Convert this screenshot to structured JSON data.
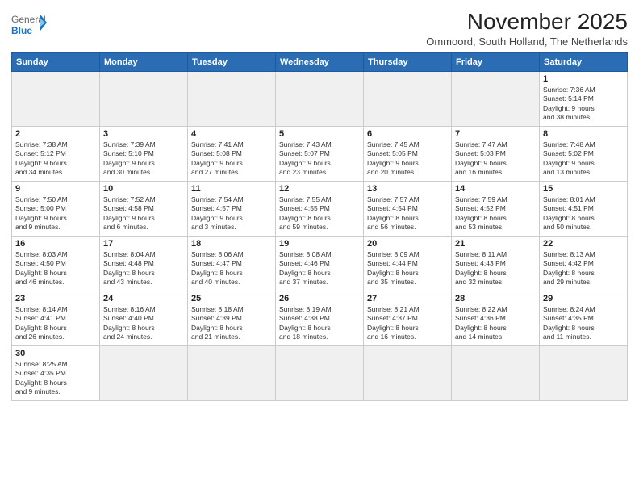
{
  "header": {
    "logo_general": "General",
    "logo_blue": "Blue",
    "title": "November 2025",
    "subtitle": "Ommoord, South Holland, The Netherlands"
  },
  "weekdays": [
    "Sunday",
    "Monday",
    "Tuesday",
    "Wednesday",
    "Thursday",
    "Friday",
    "Saturday"
  ],
  "weeks": [
    [
      {
        "day": "",
        "info": ""
      },
      {
        "day": "",
        "info": ""
      },
      {
        "day": "",
        "info": ""
      },
      {
        "day": "",
        "info": ""
      },
      {
        "day": "",
        "info": ""
      },
      {
        "day": "",
        "info": ""
      },
      {
        "day": "1",
        "info": "Sunrise: 7:36 AM\nSunset: 5:14 PM\nDaylight: 9 hours\nand 38 minutes."
      }
    ],
    [
      {
        "day": "2",
        "info": "Sunrise: 7:38 AM\nSunset: 5:12 PM\nDaylight: 9 hours\nand 34 minutes."
      },
      {
        "day": "3",
        "info": "Sunrise: 7:39 AM\nSunset: 5:10 PM\nDaylight: 9 hours\nand 30 minutes."
      },
      {
        "day": "4",
        "info": "Sunrise: 7:41 AM\nSunset: 5:08 PM\nDaylight: 9 hours\nand 27 minutes."
      },
      {
        "day": "5",
        "info": "Sunrise: 7:43 AM\nSunset: 5:07 PM\nDaylight: 9 hours\nand 23 minutes."
      },
      {
        "day": "6",
        "info": "Sunrise: 7:45 AM\nSunset: 5:05 PM\nDaylight: 9 hours\nand 20 minutes."
      },
      {
        "day": "7",
        "info": "Sunrise: 7:47 AM\nSunset: 5:03 PM\nDaylight: 9 hours\nand 16 minutes."
      },
      {
        "day": "8",
        "info": "Sunrise: 7:48 AM\nSunset: 5:02 PM\nDaylight: 9 hours\nand 13 minutes."
      }
    ],
    [
      {
        "day": "9",
        "info": "Sunrise: 7:50 AM\nSunset: 5:00 PM\nDaylight: 9 hours\nand 9 minutes."
      },
      {
        "day": "10",
        "info": "Sunrise: 7:52 AM\nSunset: 4:58 PM\nDaylight: 9 hours\nand 6 minutes."
      },
      {
        "day": "11",
        "info": "Sunrise: 7:54 AM\nSunset: 4:57 PM\nDaylight: 9 hours\nand 3 minutes."
      },
      {
        "day": "12",
        "info": "Sunrise: 7:55 AM\nSunset: 4:55 PM\nDaylight: 8 hours\nand 59 minutes."
      },
      {
        "day": "13",
        "info": "Sunrise: 7:57 AM\nSunset: 4:54 PM\nDaylight: 8 hours\nand 56 minutes."
      },
      {
        "day": "14",
        "info": "Sunrise: 7:59 AM\nSunset: 4:52 PM\nDaylight: 8 hours\nand 53 minutes."
      },
      {
        "day": "15",
        "info": "Sunrise: 8:01 AM\nSunset: 4:51 PM\nDaylight: 8 hours\nand 50 minutes."
      }
    ],
    [
      {
        "day": "16",
        "info": "Sunrise: 8:03 AM\nSunset: 4:50 PM\nDaylight: 8 hours\nand 46 minutes."
      },
      {
        "day": "17",
        "info": "Sunrise: 8:04 AM\nSunset: 4:48 PM\nDaylight: 8 hours\nand 43 minutes."
      },
      {
        "day": "18",
        "info": "Sunrise: 8:06 AM\nSunset: 4:47 PM\nDaylight: 8 hours\nand 40 minutes."
      },
      {
        "day": "19",
        "info": "Sunrise: 8:08 AM\nSunset: 4:46 PM\nDaylight: 8 hours\nand 37 minutes."
      },
      {
        "day": "20",
        "info": "Sunrise: 8:09 AM\nSunset: 4:44 PM\nDaylight: 8 hours\nand 35 minutes."
      },
      {
        "day": "21",
        "info": "Sunrise: 8:11 AM\nSunset: 4:43 PM\nDaylight: 8 hours\nand 32 minutes."
      },
      {
        "day": "22",
        "info": "Sunrise: 8:13 AM\nSunset: 4:42 PM\nDaylight: 8 hours\nand 29 minutes."
      }
    ],
    [
      {
        "day": "23",
        "info": "Sunrise: 8:14 AM\nSunset: 4:41 PM\nDaylight: 8 hours\nand 26 minutes."
      },
      {
        "day": "24",
        "info": "Sunrise: 8:16 AM\nSunset: 4:40 PM\nDaylight: 8 hours\nand 24 minutes."
      },
      {
        "day": "25",
        "info": "Sunrise: 8:18 AM\nSunset: 4:39 PM\nDaylight: 8 hours\nand 21 minutes."
      },
      {
        "day": "26",
        "info": "Sunrise: 8:19 AM\nSunset: 4:38 PM\nDaylight: 8 hours\nand 18 minutes."
      },
      {
        "day": "27",
        "info": "Sunrise: 8:21 AM\nSunset: 4:37 PM\nDaylight: 8 hours\nand 16 minutes."
      },
      {
        "day": "28",
        "info": "Sunrise: 8:22 AM\nSunset: 4:36 PM\nDaylight: 8 hours\nand 14 minutes."
      },
      {
        "day": "29",
        "info": "Sunrise: 8:24 AM\nSunset: 4:35 PM\nDaylight: 8 hours\nand 11 minutes."
      }
    ],
    [
      {
        "day": "30",
        "info": "Sunrise: 8:25 AM\nSunset: 4:35 PM\nDaylight: 8 hours\nand 9 minutes."
      },
      {
        "day": "",
        "info": ""
      },
      {
        "day": "",
        "info": ""
      },
      {
        "day": "",
        "info": ""
      },
      {
        "day": "",
        "info": ""
      },
      {
        "day": "",
        "info": ""
      },
      {
        "day": "",
        "info": ""
      }
    ]
  ]
}
